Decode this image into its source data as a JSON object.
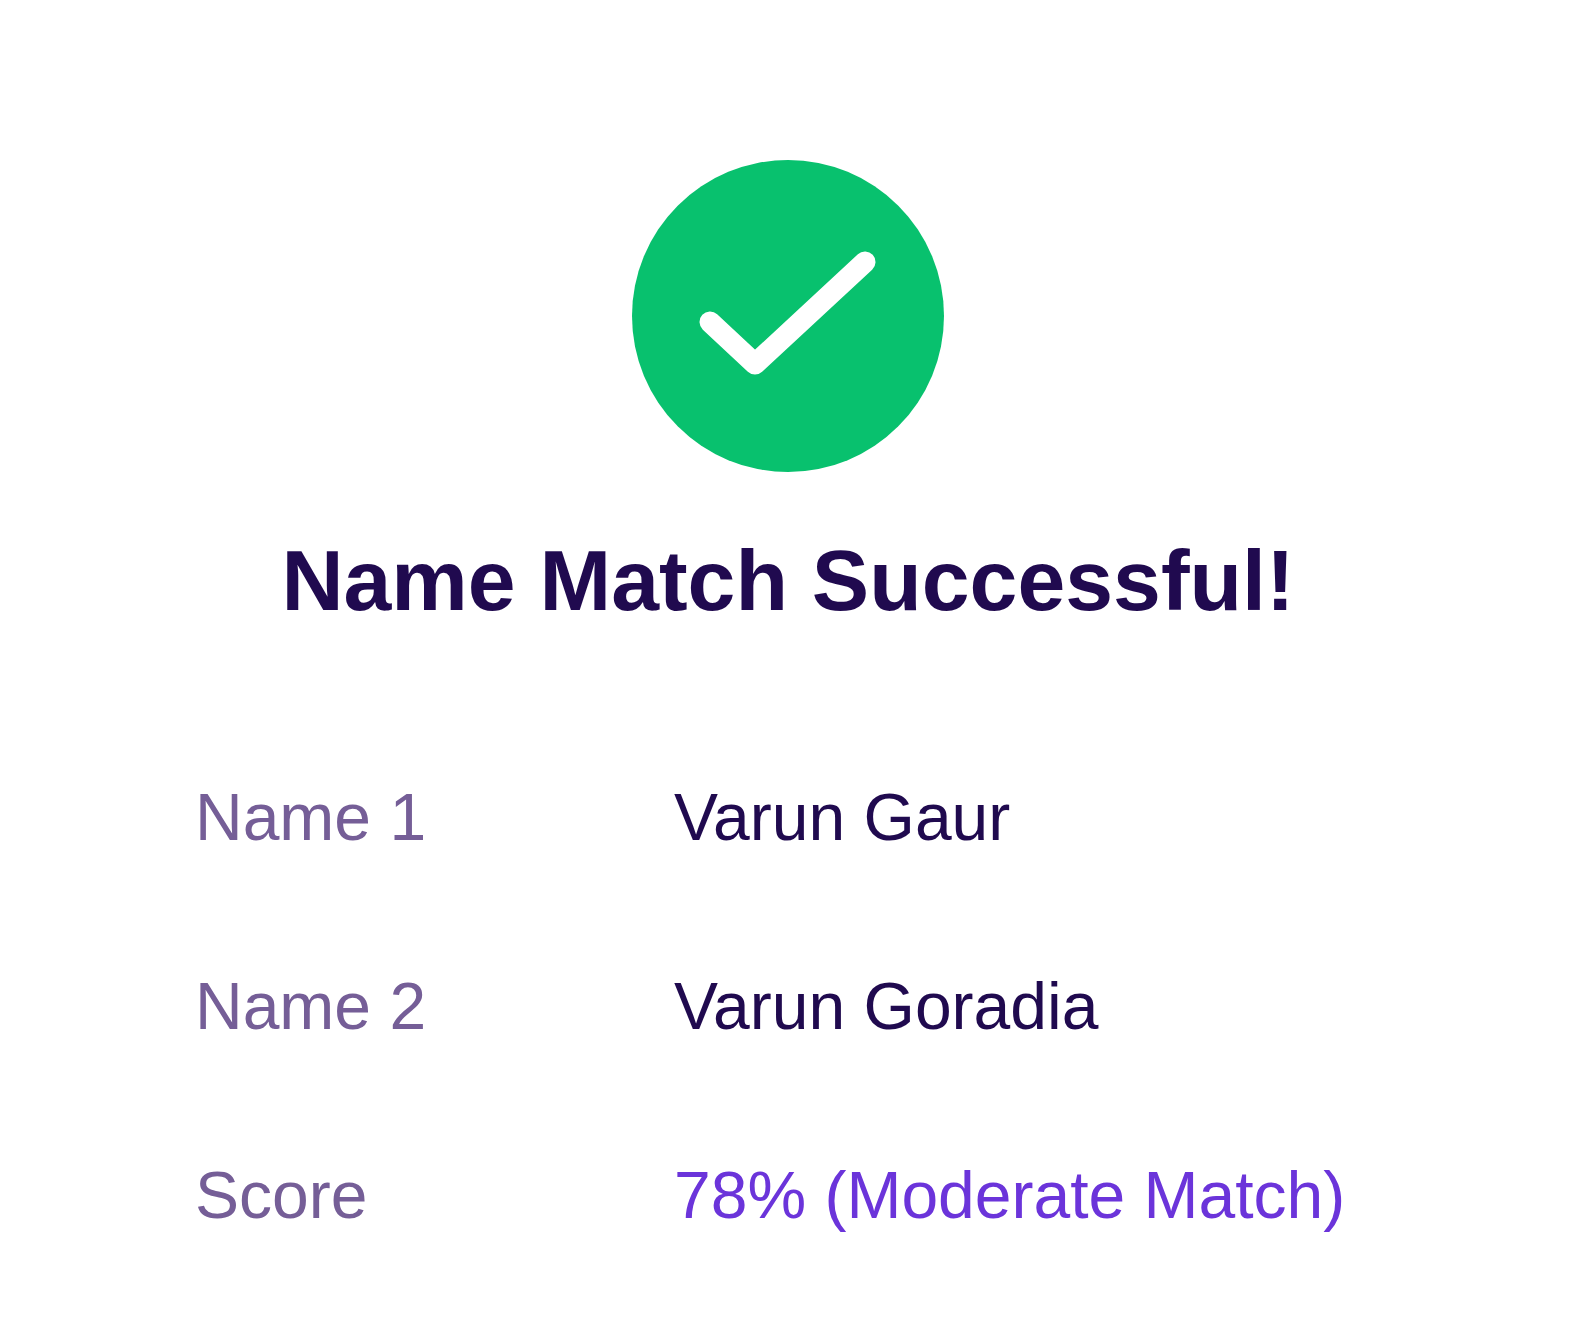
{
  "status": {
    "kind": "success"
  },
  "title": "Name Match Successful!",
  "rows": [
    {
      "label": "Name 1",
      "value": "Varun Gaur",
      "kind": "plain"
    },
    {
      "label": "Name 2",
      "value": "Varun Goradia",
      "kind": "plain"
    },
    {
      "label": "Score",
      "value": "78% (Moderate Match)",
      "kind": "highlight"
    }
  ]
}
